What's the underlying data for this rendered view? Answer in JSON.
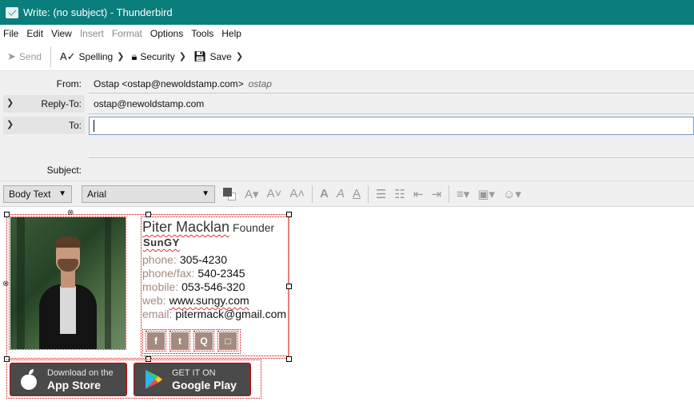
{
  "window": {
    "title": "Write: (no subject) - Thunderbird"
  },
  "menu": [
    {
      "label": "File",
      "enabled": true
    },
    {
      "label": "Edit",
      "enabled": true
    },
    {
      "label": "View",
      "enabled": true
    },
    {
      "label": "Insert",
      "enabled": false
    },
    {
      "label": "Format",
      "enabled": false
    },
    {
      "label": "Options",
      "enabled": true
    },
    {
      "label": "Tools",
      "enabled": true
    },
    {
      "label": "Help",
      "enabled": true
    }
  ],
  "toolbar": {
    "send_label": "Send",
    "spelling_label": "Spelling",
    "security_label": "Security",
    "save_label": "Save"
  },
  "headers": {
    "from_label": "From:",
    "from_value": "Ostap <ostap@newoldstamp.com>",
    "from_nick": "ostap",
    "replyto_label": "Reply-To:",
    "replyto_value": "ostap@newoldstamp.com",
    "to_label": "To:",
    "to_value": "",
    "subject_label": "Subject:",
    "subject_value": ""
  },
  "format": {
    "paragraph_style": "Body Text",
    "font": "Arial"
  },
  "signature": {
    "name": "Piter Macklan",
    "title": "Founder",
    "company": "SunGY",
    "contacts": [
      {
        "key": "phone:",
        "value": "305-4230"
      },
      {
        "key": "phone/fax:",
        "value": "540-2345"
      },
      {
        "key": "mobile:",
        "value": "053-546-320"
      },
      {
        "key": "web:",
        "value": "www.sungy.com"
      },
      {
        "key": "email:",
        "value": "pitermack@gmail.com"
      }
    ],
    "social": [
      {
        "icon": "facebook-icon",
        "glyph": "f"
      },
      {
        "icon": "twitter-icon",
        "glyph": "t"
      },
      {
        "icon": "quora-icon",
        "glyph": "Q"
      },
      {
        "icon": "shop-icon",
        "glyph": "□"
      }
    ],
    "app_store": {
      "small": "Download on the",
      "big": "App Store"
    },
    "google_play": {
      "small": "GET IT ON",
      "big": "Google Play"
    },
    "accent_color": "#a38b80"
  }
}
